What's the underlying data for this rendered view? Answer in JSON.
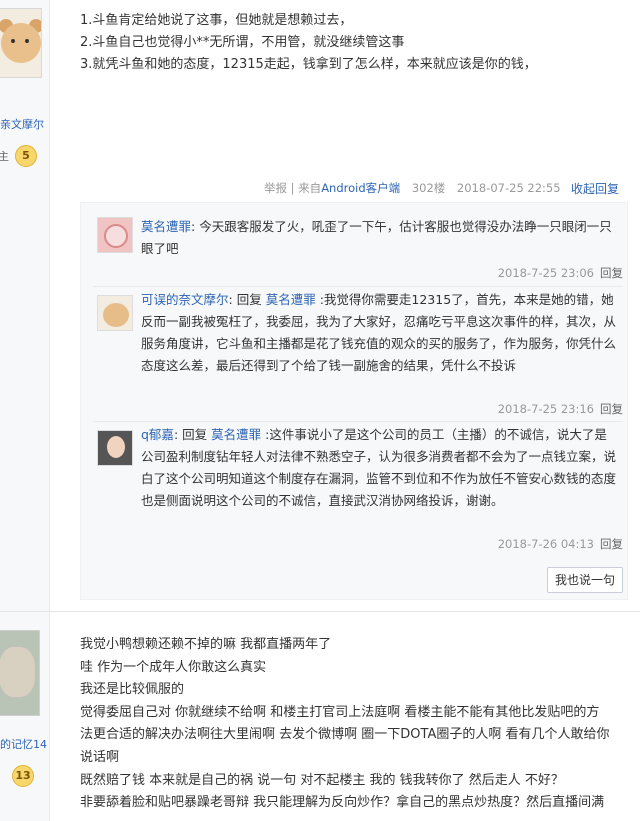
{
  "post1": {
    "user_name": "亲文摩尔",
    "level_text": "主",
    "level": "5",
    "lines": [
      "1.斗鱼肯定给她说了这事，但她就是想赖过去，",
      "2.斗鱼自己也觉得小**无所谓，不用管，就没继续管这事",
      "3.就凭斗鱼和她的态度，12315走起，钱拿到了怎么样，本来就应该是你的钱，"
    ],
    "meta": {
      "report": "举报",
      "client": "来自Android客户端",
      "floor": "302楼",
      "time": "2018-07-25 22:55",
      "collapse": "收起回复"
    }
  },
  "replies": [
    {
      "user": "莫名遭罪",
      "text": "今天跟客服发了火，吼歪了一下午，估计客服也觉得没办法睁一只眼闭一只眼了吧",
      "time": "2018-7-25 23:06",
      "reply_label": "回复"
    },
    {
      "user": "可误的奈文摩尔",
      "reply_word": "回复",
      "target": "莫名遭罪",
      "text": "我觉得你需要走12315了，首先，本来是她的错，她反而一副我被冤枉了，我委屈，我为了大家好，忍痛吃亏平息这次事件的样，其次，从服务角度讲，它斗鱼和主播都是花了钱充值的观众的买的服务了，作为服务，你凭什么态度这么差，最后还得到了个给了钱一副施舍的结果，凭什么不投诉",
      "time": "2018-7-25 23:16",
      "reply_label": "回复"
    },
    {
      "user": "q郁嘉",
      "reply_word": "回复",
      "target": "莫名遭罪",
      "text": "这件事说小了是这个公司的员工（主播）的不诚信，说大了是公司盈利制度钻年轻人对法律不熟悉空子，认为很多消费者都不会为了一点钱立案，说白了这个公司明知道这个制度存在漏洞，监管不到位和不作为放任不管安心数钱的态度也是侧面说明这个公司的不诚信，直接武汉消协网络投诉，谢谢。",
      "time": "2018-7-26 04:13",
      "reply_label": "回复"
    }
  ],
  "say_button": "我也说一句",
  "post2": {
    "user_name": "的记忆14",
    "level": "13",
    "lines": [
      "我觉小鸭想赖还赖不掉的嘛 我都直播两年了",
      "哇 作为一个成年人你敢这么真实",
      "我还是比较佩服的",
      "觉得委屈自己对 你就继续不给啊 和楼主打官司上法庭啊 看楼主能不能有其他比发贴吧的方",
      "法更合适的解决办法啊往大里闹啊 去发个微博啊 圈一下DOTA圈子的人啊 看有几个人敢给你",
      "说话啊",
      "既然赔了钱 本来就是自己的祸 说一句 对不起楼主 我的 钱我转你了 然后走人 不好？",
      "非要舔着脸和贴吧暴躁老哥辩 我只能理解为反向炒作？拿自己的黑点炒热度？然后直播间满"
    ]
  }
}
